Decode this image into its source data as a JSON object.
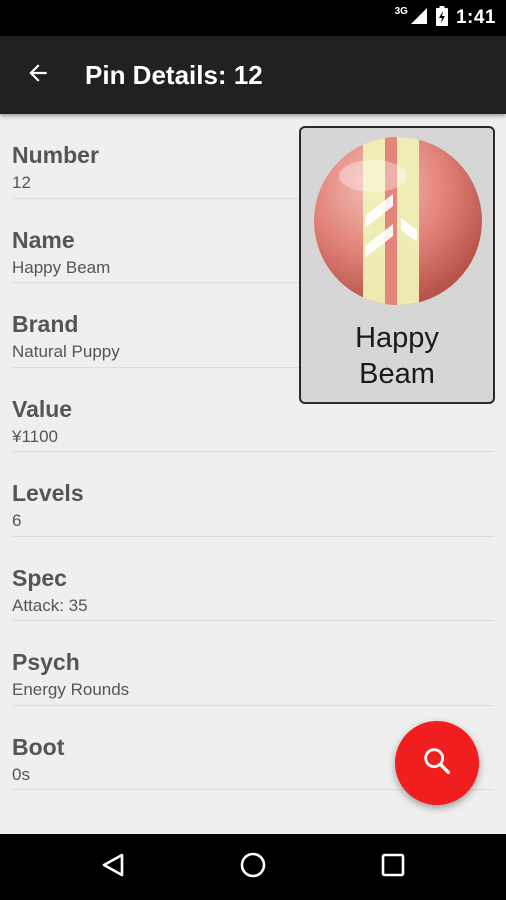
{
  "status_bar": {
    "network_label": "3G",
    "time": "1:41",
    "icons": [
      "signal-icon",
      "battery-icon"
    ]
  },
  "app_bar": {
    "back_icon": "arrow-back-icon",
    "title": "Pin Details: 12"
  },
  "fields": [
    {
      "label": "Number",
      "value": "12"
    },
    {
      "label": "Name",
      "value": "Happy Beam"
    },
    {
      "label": "Brand",
      "value": "Natural Puppy"
    },
    {
      "label": "Value",
      "value": "¥1100"
    },
    {
      "label": "Levels",
      "value": "6"
    },
    {
      "label": "Spec",
      "value": "Attack: 35"
    },
    {
      "label": "Psych",
      "value": "Energy Rounds"
    },
    {
      "label": "Boot",
      "value": "0s"
    }
  ],
  "pin_card": {
    "name_line1": "Happy",
    "name_line2": "Beam"
  },
  "fab": {
    "icon": "search-icon",
    "color": "#f01e1e"
  },
  "nav_bar": {
    "icons": [
      "back-triangle-icon",
      "home-circle-icon",
      "recents-square-icon"
    ]
  },
  "colors": {
    "app_bar": "#212121",
    "background": "#efefef",
    "pin_pink": "#e3857b",
    "pin_stripe": "#f0f0b8"
  }
}
